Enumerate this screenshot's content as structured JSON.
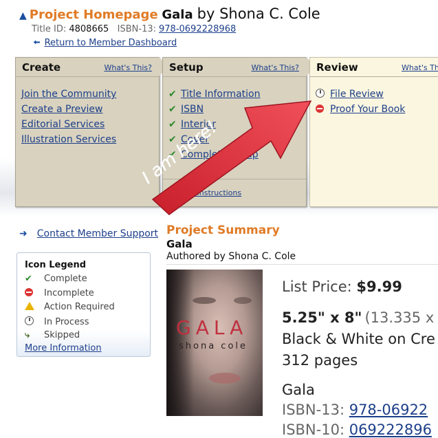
{
  "header": {
    "home_label": "Project Homepage",
    "project_name": "Gala",
    "by_author": "by Shona C. Cole",
    "title_id_label": "Title ID:",
    "title_id": "4808665",
    "isbn13_label": "ISBN-13:",
    "isbn13": "978-0692228968",
    "return_link": "Return to Member Dashboard"
  },
  "panels": {
    "create": {
      "title": "Create",
      "whats_this": "What's This?",
      "items": [
        "Join the Community",
        "Create a Preview",
        "Editorial Services",
        "Illustration Services"
      ]
    },
    "setup": {
      "title": "Setup",
      "whats_this": "What's This?",
      "items": [
        "Title Information",
        "ISBN",
        "Interior",
        "Cover",
        "Complete Setup"
      ],
      "instructions": "Setup Instructions"
    },
    "review": {
      "title": "Review",
      "whats_this": "What's This?",
      "items": [
        "File Review",
        "Proof Your Book"
      ]
    }
  },
  "annotation": {
    "arrow_text": "I am here!",
    "arrow_color": "#e8303a"
  },
  "support": {
    "label": "Contact Member Support"
  },
  "legend": {
    "title": "Icon Legend",
    "items": [
      "Complete",
      "Incomplete",
      "Action Required",
      "In Process",
      "Skipped"
    ],
    "more": "More Information"
  },
  "summary": {
    "heading": "Project Summary",
    "title": "Gala",
    "authored_by": "Authored by Shona C. Cole",
    "cover_title": "GALA",
    "cover_author": "shona cole",
    "list_price_label": "List Price:",
    "list_price": "$9.99",
    "trim_size": "5.25\" x 8\"",
    "trim_metric": "(13.335 x",
    "paper": "Black & White on Cre",
    "pages": "312 pages",
    "book_title": "Gala",
    "isbn13_label": "ISBN-13:",
    "isbn13": "978-06922",
    "isbn10_label": "ISBN-10:",
    "isbn10": "069222896"
  },
  "colors": {
    "accent_orange": "#e07b26",
    "link_blue": "#1d3f8a",
    "panel_bg": "#d8d2bf",
    "review_bg": "#fbf6e0"
  }
}
